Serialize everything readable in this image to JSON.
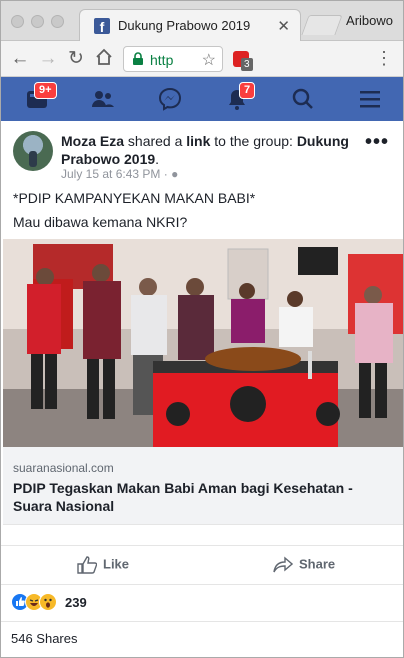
{
  "browser": {
    "tab_title": "Dukung Prabowo 2019",
    "profile_name": "Aribowo",
    "url": "http",
    "extension_badge": "3"
  },
  "fb_nav": {
    "home_badge": "9+",
    "notifications_badge": "7"
  },
  "post": {
    "author": "Moza Eza",
    "shared_text": " shared a ",
    "link_word": "link",
    "to_group_text": " to the group: ",
    "group_name": "Dukung Prabowo 2019",
    "period": ".",
    "timestamp": "July 15 at 6:43 PM",
    "body_line1": "*PDIP KAMPANYEKAN MAKAN BABI*",
    "body_line2": "Mau dibawa kemana NKRI?",
    "link_domain": "suaranasional.com",
    "link_title": "PDIP Tegaskan Makan Babi Aman bagi Kesehatan - Suara Nasional",
    "like_label": "Like",
    "share_label": "Share",
    "reaction_count": "239",
    "shares_count": "546 Shares"
  },
  "colors": {
    "fb_blue": "#4267b2",
    "badge_red": "#fa3e3e",
    "secure_green": "#0a8043"
  }
}
